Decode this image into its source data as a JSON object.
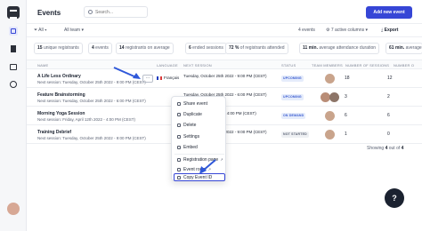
{
  "page": {
    "title": "Events"
  },
  "search": {
    "placeholder": "Search..."
  },
  "header": {
    "add_button": "Add new event"
  },
  "filters": {
    "all": "All",
    "team": "All team",
    "events_count": "4 events",
    "columns": "7 active columns",
    "export": "Export"
  },
  "stats": [
    {
      "value": "15",
      "label": "unique registrants"
    },
    {
      "value": "4",
      "label": "events"
    },
    {
      "value": "14",
      "label": "registrants on average"
    },
    {
      "value": "6",
      "label": "ended sessions"
    },
    {
      "value": "72 %",
      "label": "of registrants attended"
    },
    {
      "value": "11 min.",
      "label": "average attendance duration"
    },
    {
      "value": "61 min.",
      "label": "average"
    }
  ],
  "columns": [
    "NAME",
    "LANGUAGE",
    "NEXT SESSION",
    "STATUS",
    "TEAM MEMBERS",
    "NUMBER OF SESSIONS",
    "NUMBER O"
  ],
  "rows": [
    {
      "name": "A Life Less Ordinary",
      "next": "Next session: Tuesday, October 25th 2022 - 9:00 PM (CEST)",
      "language": "Français",
      "session": "Tuesday, October 25th 2022 - 9:00 PM (CEST)",
      "status": "UPCOMING",
      "sessions": "18",
      "other": "12"
    },
    {
      "name": "Feature Brainstorming",
      "next": "Next session: Tuesday, October 25th 2022 - 6:00 PM (CEST)",
      "language": "",
      "session": "Tuesday, October 25th 2022 - 6:00 PM (CEST)",
      "status": "UPCOMING",
      "sessions": "3",
      "other": "2"
    },
    {
      "name": "Morning Yoga Session",
      "next": "Next session: Friday, April 12th 2022 - 4:00 PM (CEST)",
      "language": "",
      "session": "Friday, April 12th 2022 - 4:00 PM (CEST)",
      "status": "ON DEMAND",
      "sessions": "6",
      "other": "6"
    },
    {
      "name": "Training Debrief",
      "next": "Next session: Tuesday, October 25th 2022 - 9:00 PM (CEST)",
      "language": "",
      "session": "Tuesday, October 25th 2022 - 9:00 PM (CEST)",
      "status": "NOT STARTED",
      "sessions": "1",
      "other": "0"
    }
  ],
  "menu": [
    "Share event",
    "Duplicate",
    "Delete",
    "Settings",
    "Embed",
    "Registration page",
    "Event room",
    "Copy Event ID"
  ],
  "footer": {
    "showing": "Showing",
    "count": "4",
    "of": "out of",
    "total": "4"
  },
  "help": "?"
}
